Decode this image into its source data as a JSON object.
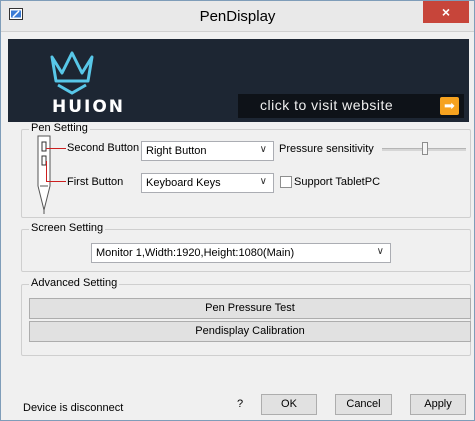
{
  "window": {
    "title": "PenDisplay",
    "close_glyph": "×"
  },
  "banner": {
    "logo_text": "HUION",
    "visit_text": "click to visit website",
    "arrow_glyph": "➡",
    "arrow_color": "#f6a21f",
    "background": "#1d2633"
  },
  "pen_setting": {
    "title": "Pen Setting",
    "second_button_label": "Second Button",
    "second_button_value": "Right Button",
    "first_button_label": "First Button",
    "first_button_value": "Keyboard Keys",
    "pressure_label": "Pressure sensitivity",
    "pressure_level": 0.55,
    "support_tabletpc_label": "Support TabletPC",
    "support_tabletpc_checked": false
  },
  "screen_setting": {
    "title": "Screen Setting",
    "monitor_value": "Monitor 1,Width:1920,Height:1080(Main)"
  },
  "advanced_setting": {
    "title": "Advanced Setting",
    "pen_pressure_test_label": "Pen Pressure Test",
    "calibration_label": "Pendisplay Calibration"
  },
  "footer": {
    "status_text": "Device is disconnect",
    "help_label": "?",
    "ok_label": "OK",
    "cancel_label": "Cancel",
    "apply_label": "Apply"
  },
  "icons": {
    "chevron": "∨"
  }
}
